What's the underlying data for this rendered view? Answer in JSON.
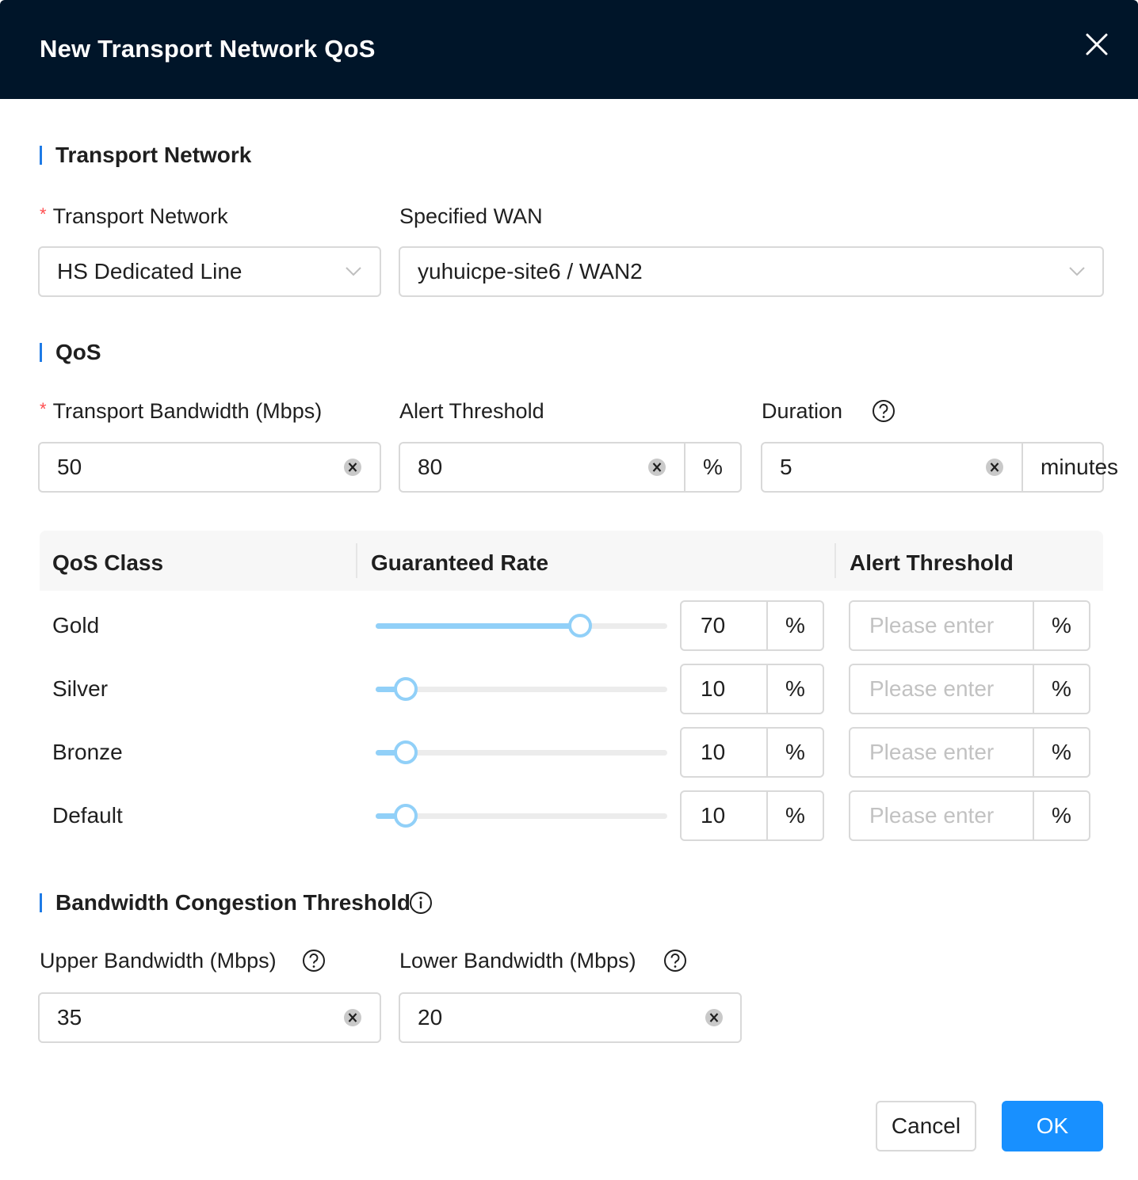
{
  "dialog": {
    "title": "New Transport Network QoS"
  },
  "transport_section": {
    "title": "Transport Network",
    "network_label": "Transport Network",
    "network_required_mark": "*",
    "network_value": "HS Dedicated Line",
    "wan_label": "Specified WAN",
    "wan_value": "yuhuicpe-site6 / WAN2"
  },
  "qos_section": {
    "title": "QoS",
    "bandwidth_label": "Transport Bandwidth (Mbps)",
    "bandwidth_required_mark": "*",
    "bandwidth_value": "50",
    "alert_label": "Alert Threshold",
    "alert_value": "80",
    "alert_unit": "%",
    "duration_label": "Duration",
    "duration_value": "5",
    "duration_unit": "minutes"
  },
  "qos_table": {
    "columns": [
      "QoS Class",
      "Guaranteed Rate",
      "Alert Threshold"
    ],
    "rows": [
      {
        "class": "Gold",
        "rate": "70",
        "rate_fraction": 0.7,
        "rate_unit": "%",
        "threshold_placeholder": "Please enter",
        "threshold_unit": "%"
      },
      {
        "class": "Silver",
        "rate": "10",
        "rate_fraction": 0.1,
        "rate_unit": "%",
        "threshold_placeholder": "Please enter",
        "threshold_unit": "%"
      },
      {
        "class": "Bronze",
        "rate": "10",
        "rate_fraction": 0.1,
        "rate_unit": "%",
        "threshold_placeholder": "Please enter",
        "threshold_unit": "%"
      },
      {
        "class": "Default",
        "rate": "10",
        "rate_fraction": 0.1,
        "rate_unit": "%",
        "threshold_placeholder": "Please enter",
        "threshold_unit": "%"
      }
    ]
  },
  "congestion_section": {
    "title": "Bandwidth Congestion Threshold",
    "upper_label": "Upper Bandwidth (Mbps)",
    "upper_value": "35",
    "lower_label": "Lower Bandwidth (Mbps)",
    "lower_value": "20"
  },
  "footer": {
    "cancel_label": "Cancel",
    "ok_label": "OK"
  },
  "colors": {
    "header_bg": "#001529",
    "accent": "#1890ff",
    "section_bar": "#1f7be6",
    "required": "#ff4d4f",
    "slider": "#91d0f8"
  },
  "icons": {
    "close": "close-icon",
    "dropdown": "chevron-down-icon",
    "clear": "clear-icon",
    "help": "question-circle-icon",
    "info": "info-circle-icon"
  }
}
